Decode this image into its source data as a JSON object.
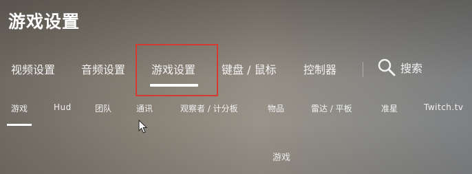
{
  "title": "游戏设置",
  "main_tabs": [
    {
      "label": "视频设置"
    },
    {
      "label": "音频设置"
    },
    {
      "label": "游戏设置",
      "active": true
    },
    {
      "label": "键盘 / 鼠标"
    },
    {
      "label": "控制器"
    }
  ],
  "search": {
    "label": "搜索",
    "icon": "search-icon"
  },
  "sub_tabs": [
    {
      "label": "游戏",
      "active": true
    },
    {
      "label": "Hud"
    },
    {
      "label": "团队"
    },
    {
      "label": "通讯"
    },
    {
      "label": "观察者 / 计分板"
    },
    {
      "label": "物品"
    },
    {
      "label": "雷达 / 平板"
    },
    {
      "label": "准星"
    },
    {
      "label": "Twitch.tv"
    }
  ],
  "section": {
    "label": "游戏"
  },
  "colors": {
    "highlight": "#d23a32",
    "text": "#ffffff"
  }
}
